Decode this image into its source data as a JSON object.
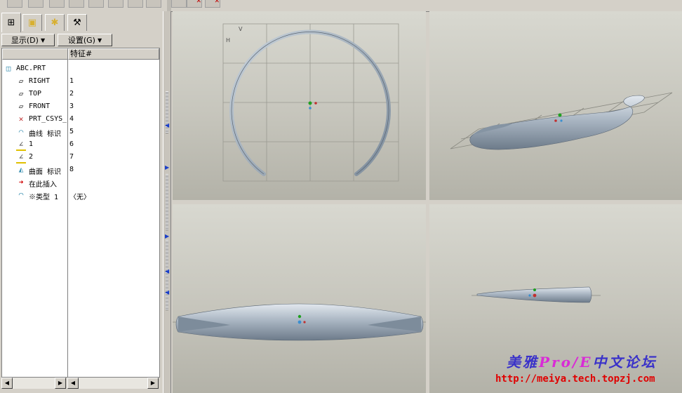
{
  "menus": {
    "display": "显示(D)",
    "settings": "设置(G)"
  },
  "tree": {
    "columns": [
      "",
      "特征#"
    ],
    "rows": [
      {
        "label": "ABC.PRT",
        "num": "",
        "icon": "part-icon"
      },
      {
        "label": "RIGHT",
        "num": "1",
        "icon": "datum-plane-icon"
      },
      {
        "label": "TOP",
        "num": "2",
        "icon": "datum-plane-icon"
      },
      {
        "label": "FRONT",
        "num": "3",
        "icon": "datum-plane-icon"
      },
      {
        "label": "PRT_CSYS_",
        "num": "4",
        "icon": "csys-icon"
      },
      {
        "label": "曲线 标识",
        "num": "5",
        "icon": "curve-icon"
      },
      {
        "label": "1",
        "num": "6",
        "icon": "sketch-icon"
      },
      {
        "label": "2",
        "num": "7",
        "icon": "sketch-icon"
      },
      {
        "label": "曲面 标识",
        "num": "8",
        "icon": "surface-icon"
      },
      {
        "label": "在此插入",
        "num": "",
        "icon": "insert-arrow-icon"
      },
      {
        "label": "※类型 1",
        "num": "〈无〉",
        "icon": "surface-icon"
      }
    ]
  },
  "watermark": {
    "brand_left": "美雅",
    "brand_pro": "Pro/E",
    "brand_right": "中文论坛",
    "url": "http://meiya.tech.topzj.com"
  },
  "colors": {
    "viewport_top": "#d8d8d0",
    "model": "#a9b6c2",
    "watermark_blue": "#3a32c9",
    "watermark_magenta": "#d92bd6",
    "url_red": "#e00000"
  }
}
